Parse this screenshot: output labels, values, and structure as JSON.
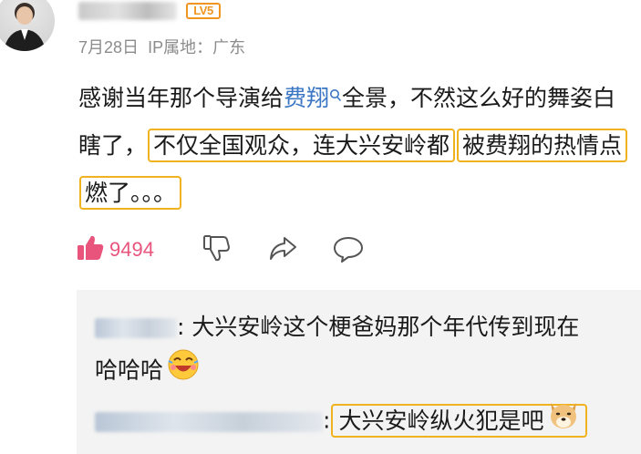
{
  "header": {
    "date": "7月28日",
    "ip_label": "IP属地：广东",
    "level_badge": "LV5",
    "avatar": "user-avatar",
    "username": ""
  },
  "comment": {
    "part1": "感谢当年那个导演给",
    "topic": "费翔",
    "part2": "全景，不然这么好的舞姿白瞎了，",
    "highlight1": "不仅全国观众，连大兴安岭都",
    "highlight2": "被费翔的热情点燃了。。。"
  },
  "actions": {
    "like_count": "9494",
    "icons": [
      "like-icon",
      "dislike-icon",
      "share-icon",
      "comment-icon"
    ],
    "like_color": "#e8547c"
  },
  "replies": [
    {
      "text_line1": "大兴安岭这个梗爸妈那个年代传到现在",
      "text_line2": "哈哈哈",
      "emoji": "laughing-emoji"
    },
    {
      "text": "大兴安岭纵火犯是吧",
      "emoji": "doge-emoji"
    }
  ],
  "colors": {
    "highlight_border": "#f0b21e",
    "topic": "#3b76c4",
    "reply_bg": "#f3f3f3"
  }
}
